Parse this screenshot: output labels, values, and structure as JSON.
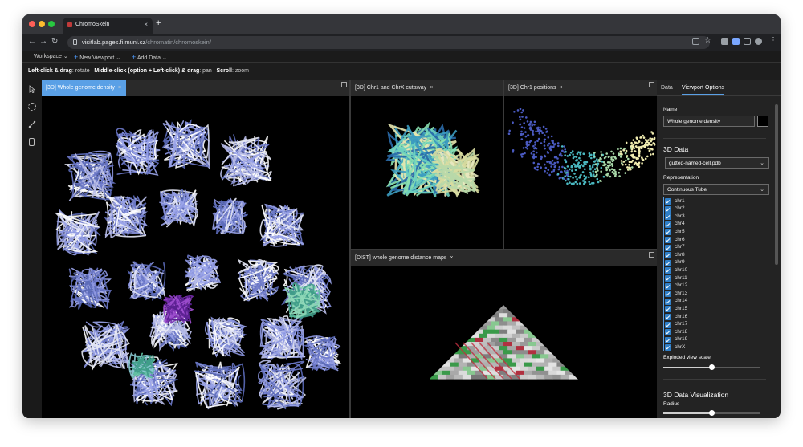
{
  "browser": {
    "tab_title": "ChromoSkein",
    "tab_close": "×",
    "new_tab": "+",
    "url_host": "visitlab.pages.fi.muni.cz",
    "url_path": "/chromatin/chromoskein/",
    "traffic_colors": [
      "#ff5f57",
      "#febc2e",
      "#28c840"
    ]
  },
  "menu": {
    "workspace": "Workspace",
    "new_viewport": "New Viewport",
    "add_data": "Add Data"
  },
  "hint": {
    "lc": "Left-click & drag",
    "lc_action": ": rotate | ",
    "mc": "Middle-click (option + Left-click) & drag",
    "mc_action": ": pan | ",
    "scroll": "Scroll",
    "scroll_action": ": zoom"
  },
  "viewports": {
    "main": {
      "title": "[3D] Whole genome density",
      "close": "×"
    },
    "cutaway": {
      "title": "[3D] Chr1 and ChrX cutaway",
      "close": "×"
    },
    "positions": {
      "title": "[3D] Chr1 positions",
      "close": "×"
    },
    "distance": {
      "title": "[DIST] whole genome distance maps",
      "close": "×"
    }
  },
  "panel": {
    "tab_data": "Data",
    "tab_viewport": "Viewport Options",
    "name_label": "Name",
    "name_value": "Whole genome density",
    "data3d_title": "3D Data",
    "data3d_value": "gutted-named-cell.pdb",
    "representation_label": "Representation",
    "representation_value": "Continuous Tube",
    "chromosomes": [
      "chr1",
      "chr2",
      "chr3",
      "chr4",
      "chr5",
      "chr6",
      "chr7",
      "chr8",
      "chr9",
      "chr10",
      "chr11",
      "chr12",
      "chr13",
      "chr14",
      "chr15",
      "chr16",
      "chr17",
      "chr18",
      "chr19",
      "chrX"
    ],
    "exploded_label": "Exploded view scale",
    "exploded_value": 0.5,
    "vis_title": "3D Data Visualization",
    "radius_label": "Radius",
    "radius_value": 0.5
  },
  "colors": {
    "accent": "#5aa0e6",
    "checkbox": "#2f7fc8",
    "tube_main": "#8c96e0",
    "tube_purple": "#7a2fb0",
    "tube_teal": "#5fc0a0"
  }
}
